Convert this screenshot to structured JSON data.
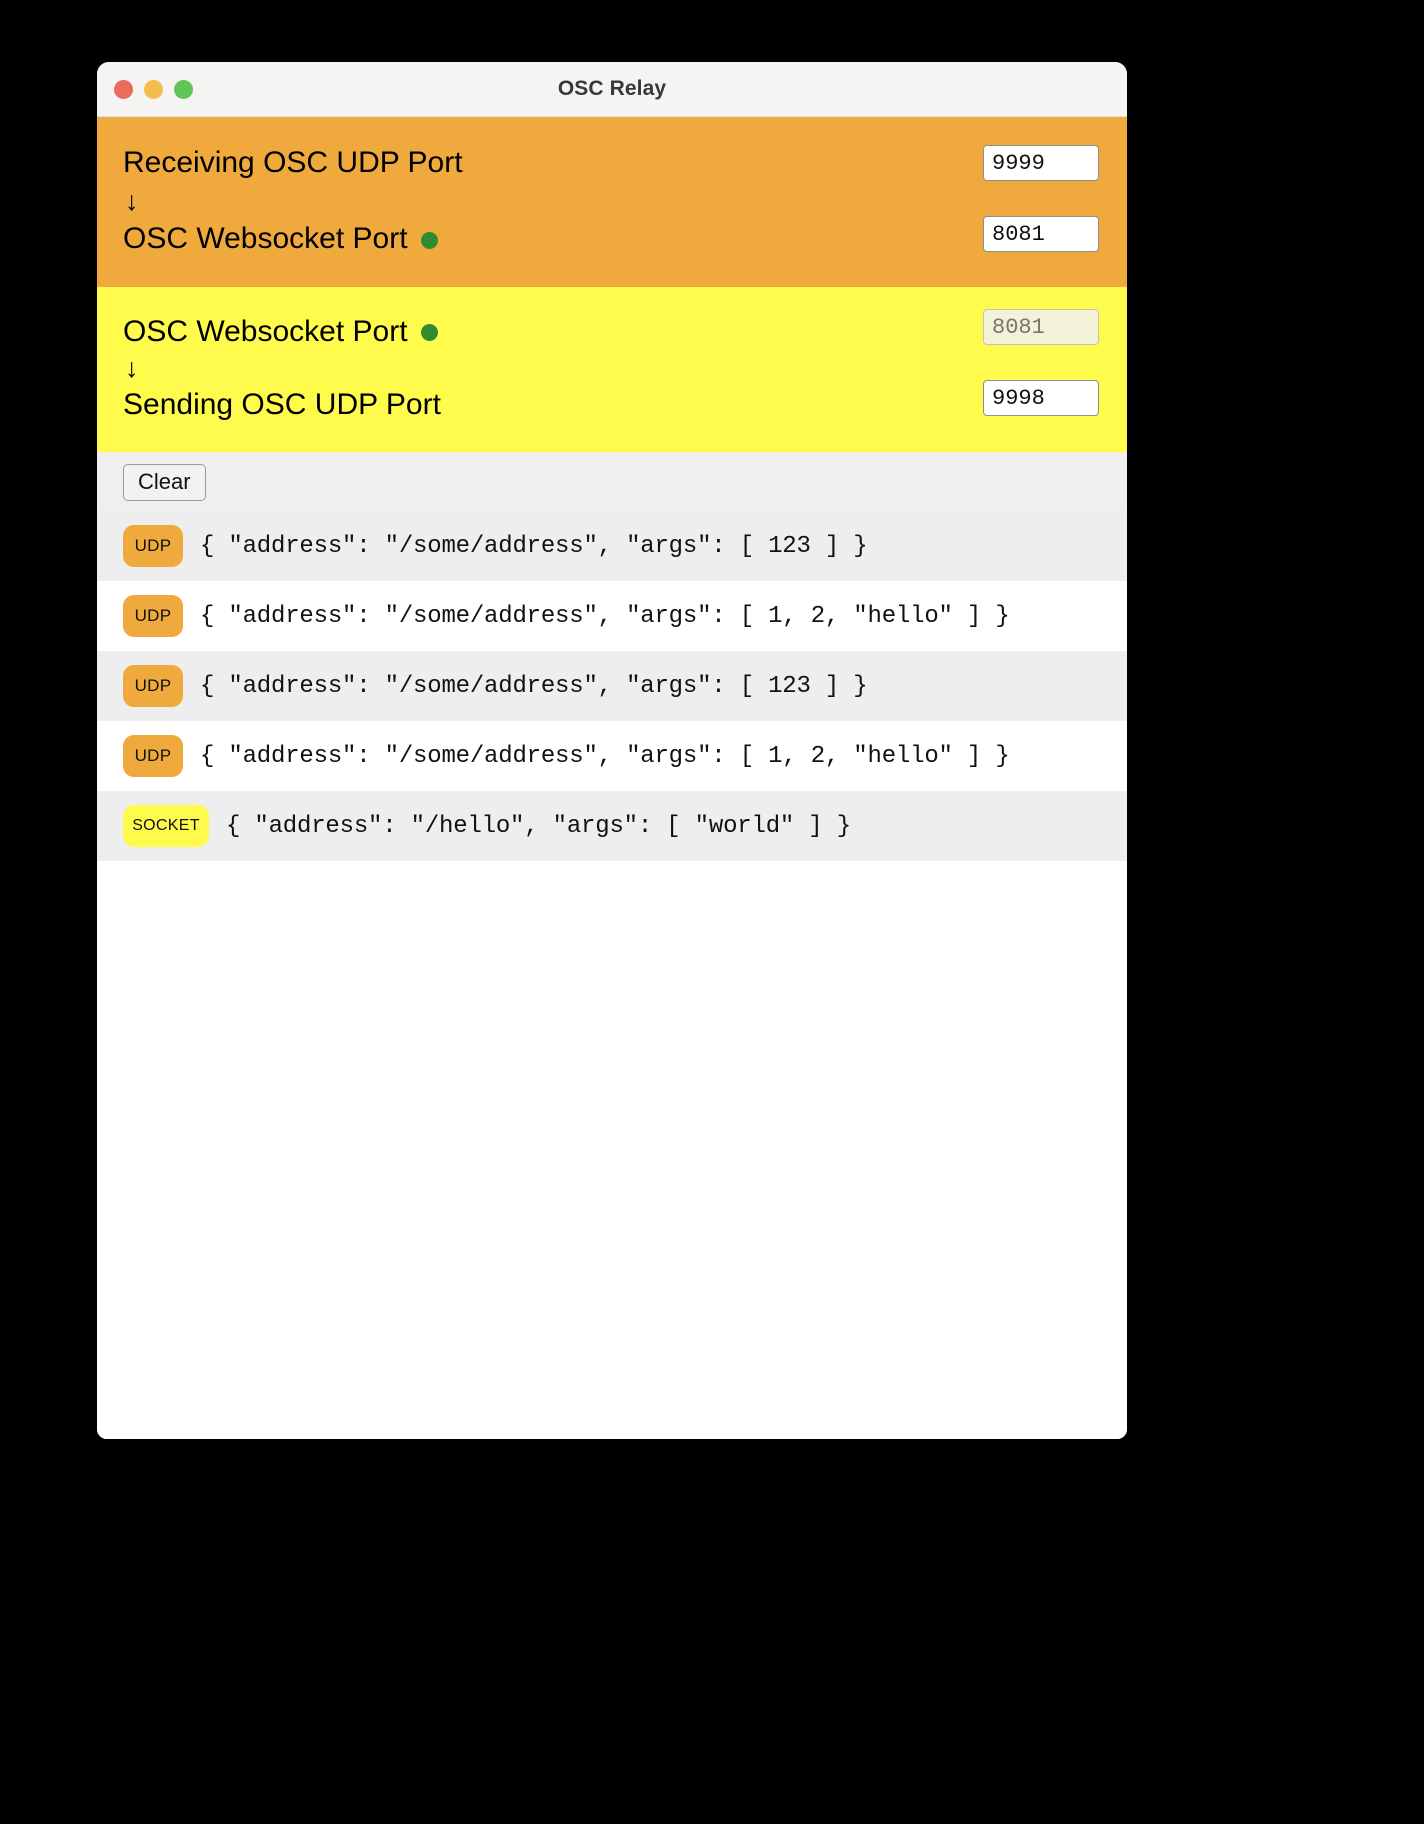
{
  "window": {
    "title": "OSC Relay",
    "traffic_lights": [
      {
        "name": "close",
        "color": "#ed6a5f"
      },
      {
        "name": "minimize",
        "color": "#f5bd4f"
      },
      {
        "name": "maximize",
        "color": "#61c454"
      }
    ]
  },
  "colors": {
    "incoming_panel": "#efa93c",
    "outgoing_panel": "#fffb4d",
    "status_dot": "#2f8b2f",
    "udp_badge": "#efa93c",
    "socket_badge": "#fffb4d",
    "row_stripe": "#eeeeee"
  },
  "incoming": {
    "source_label": "Receiving OSC UDP Port",
    "arrow": "↓",
    "target_label": "OSC Websocket Port",
    "target_status": "connected",
    "source_port": "9999",
    "target_port": "8081"
  },
  "outgoing": {
    "source_label": "OSC Websocket Port",
    "source_status": "connected",
    "arrow": "↓",
    "target_label": "Sending OSC UDP Port",
    "source_port": "8081",
    "source_port_disabled": true,
    "target_port": "9998"
  },
  "log": {
    "clear_label": "Clear",
    "entries": [
      {
        "badge": "UDP",
        "type": "udp",
        "message": "{ \"address\": \"/some/address\", \"args\": [ 123 ] }"
      },
      {
        "badge": "UDP",
        "type": "udp",
        "message": "{ \"address\": \"/some/address\", \"args\": [ 1, 2, \"hello\" ] }"
      },
      {
        "badge": "UDP",
        "type": "udp",
        "message": "{ \"address\": \"/some/address\", \"args\": [ 123 ] }"
      },
      {
        "badge": "UDP",
        "type": "udp",
        "message": "{ \"address\": \"/some/address\", \"args\": [ 1, 2, \"hello\" ] }"
      },
      {
        "badge": "SOCKET",
        "type": "socket",
        "message": "{ \"address\": \"/hello\", \"args\": [ \"world\" ] }"
      }
    ]
  }
}
